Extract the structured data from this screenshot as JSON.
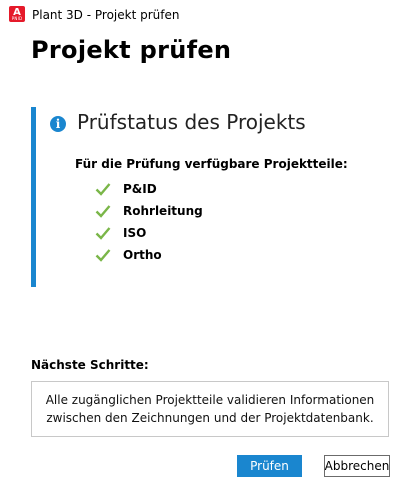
{
  "window": {
    "title": "Plant 3D - Projekt prüfen",
    "app_icon_letter": "A",
    "app_icon_sub": "PNID"
  },
  "page_title": "Projekt prüfen",
  "status": {
    "title": "Prüfstatus des Projekts",
    "icon": "info-icon",
    "available_label": "Für die Prüfung verfügbare Projektteile:",
    "parts": [
      {
        "label": "P&ID",
        "icon": "check-icon"
      },
      {
        "label": "Rohrleitung",
        "icon": "check-icon"
      },
      {
        "label": "ISO",
        "icon": "check-icon"
      },
      {
        "label": "Ortho",
        "icon": "check-icon"
      }
    ]
  },
  "next_steps": {
    "label": "Nächste Schritte:",
    "text": "Alle zugänglichen Projektteile validieren Informationen zwischen den Zeichnungen und der Projektdatenbank."
  },
  "buttons": {
    "check": "Prüfen",
    "cancel": "Abbrechen"
  },
  "colors": {
    "accent": "#1a86cf",
    "check": "#7ab648",
    "brand": "#e51a2a"
  }
}
